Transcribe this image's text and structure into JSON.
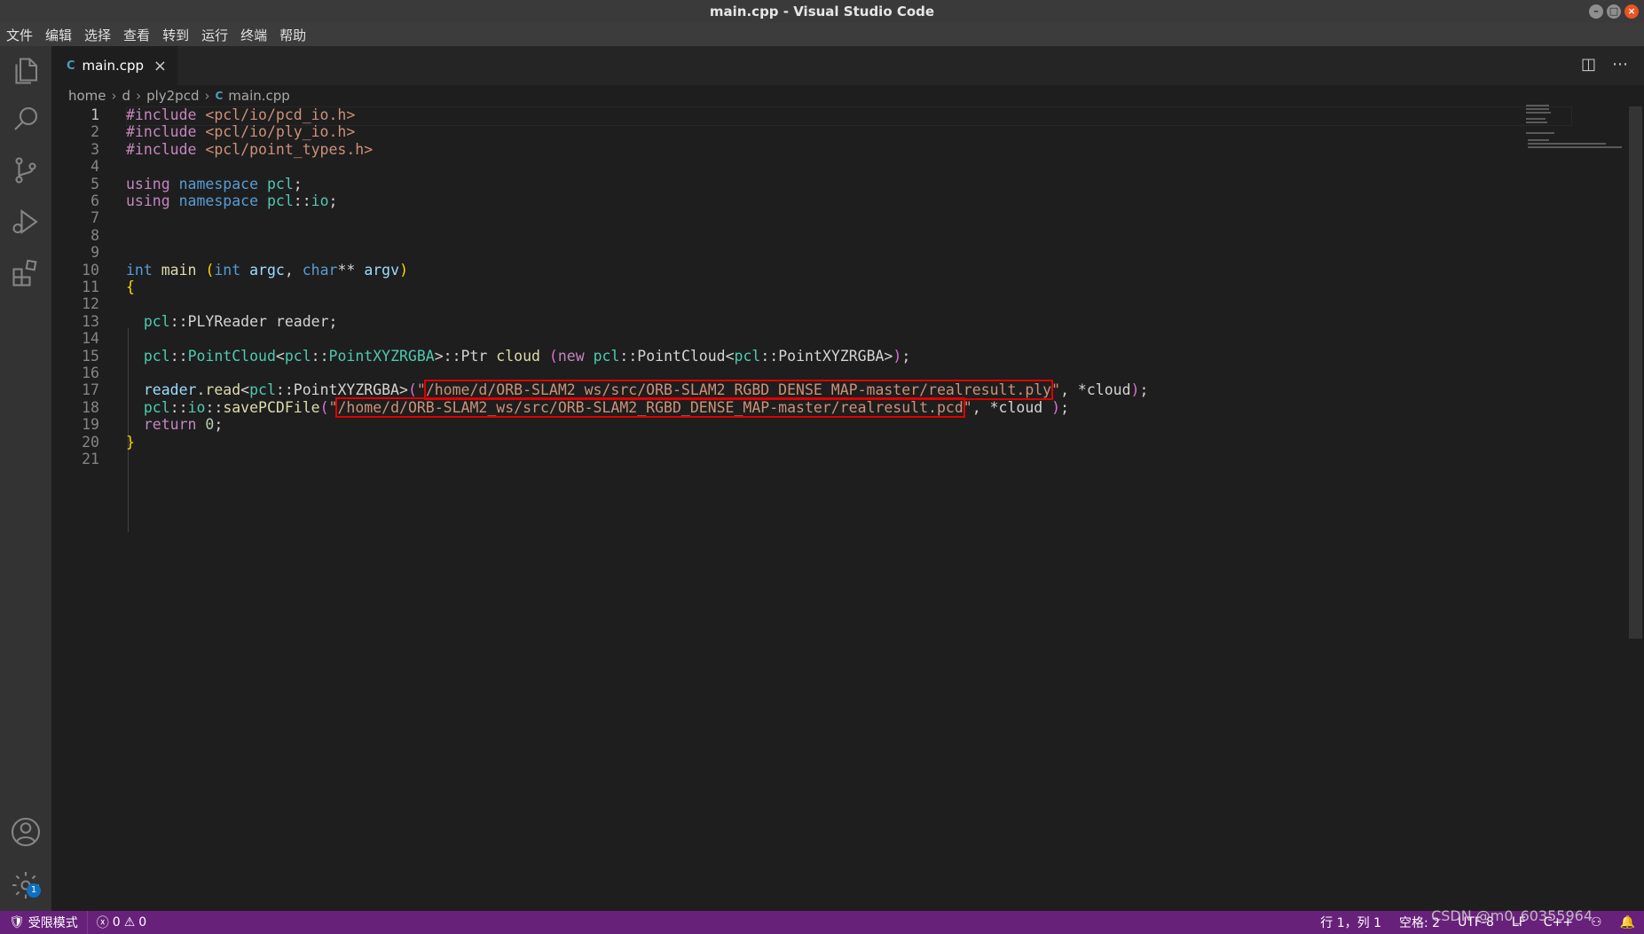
{
  "window": {
    "title": "main.cpp - Visual Studio Code"
  },
  "menu": [
    "文件",
    "编辑",
    "选择",
    "查看",
    "转到",
    "运行",
    "终端",
    "帮助"
  ],
  "activity": {
    "icons": [
      "files-icon",
      "search-icon",
      "source-control-icon",
      "run-debug-icon",
      "extensions-icon",
      "account-icon",
      "settings-gear-icon"
    ],
    "settings_badge": "1"
  },
  "tab": {
    "icon": "C",
    "label": "main.cpp",
    "close": "×"
  },
  "breadcrumb": {
    "parts": [
      "home",
      "d",
      "ply2pcd"
    ],
    "file_icon": "C",
    "file": "main.cpp",
    "sep": "›"
  },
  "editor": {
    "lines": [
      {
        "n": "1",
        "tokens": [
          [
            "kw",
            "#include"
          ],
          [
            "plain",
            " "
          ],
          [
            "str",
            "<pcl/io/pcd_io.h>"
          ]
        ]
      },
      {
        "n": "2",
        "tokens": [
          [
            "kw",
            "#include"
          ],
          [
            "plain",
            " "
          ],
          [
            "str",
            "<pcl/io/ply_io.h>"
          ]
        ]
      },
      {
        "n": "3",
        "tokens": [
          [
            "kw",
            "#include"
          ],
          [
            "plain",
            " "
          ],
          [
            "str",
            "<pcl/point_types.h>"
          ]
        ]
      },
      {
        "n": "4",
        "tokens": []
      },
      {
        "n": "5",
        "tokens": [
          [
            "kw",
            "using"
          ],
          [
            "plain",
            " "
          ],
          [
            "kw2",
            "namespace"
          ],
          [
            "plain",
            " "
          ],
          [
            "ns",
            "pcl"
          ],
          [
            "plain",
            ";"
          ]
        ]
      },
      {
        "n": "6",
        "tokens": [
          [
            "kw",
            "using"
          ],
          [
            "plain",
            " "
          ],
          [
            "kw2",
            "namespace"
          ],
          [
            "plain",
            " "
          ],
          [
            "ns",
            "pcl"
          ],
          [
            "plain",
            "::"
          ],
          [
            "ns",
            "io"
          ],
          [
            "plain",
            ";"
          ]
        ]
      },
      {
        "n": "7",
        "tokens": []
      },
      {
        "n": "8",
        "tokens": []
      },
      {
        "n": "9",
        "tokens": []
      },
      {
        "n": "10",
        "tokens": [
          [
            "kw2",
            "int"
          ],
          [
            "plain",
            " "
          ],
          [
            "fn",
            "main"
          ],
          [
            "plain",
            " "
          ],
          [
            "brace",
            "("
          ],
          [
            "kw2",
            "int"
          ],
          [
            "plain",
            " "
          ],
          [
            "var",
            "argc"
          ],
          [
            "plain",
            ", "
          ],
          [
            "kw2",
            "char"
          ],
          [
            "plain",
            "** "
          ],
          [
            "var",
            "argv"
          ],
          [
            "brace",
            ")"
          ]
        ]
      },
      {
        "n": "11",
        "tokens": [
          [
            "brace",
            "{"
          ]
        ]
      },
      {
        "n": "12",
        "tokens": []
      },
      {
        "n": "13",
        "tokens": [
          [
            "plain",
            "  "
          ],
          [
            "ns",
            "pcl"
          ],
          [
            "plain",
            "::PLYReader reader;"
          ]
        ]
      },
      {
        "n": "14",
        "tokens": []
      },
      {
        "n": "15",
        "tokens": [
          [
            "plain",
            "  "
          ],
          [
            "ns",
            "pcl"
          ],
          [
            "plain",
            "::"
          ],
          [
            "ns",
            "PointCloud"
          ],
          [
            "plain",
            "<"
          ],
          [
            "ns",
            "pcl"
          ],
          [
            "plain",
            "::"
          ],
          [
            "ns",
            "PointXYZRGBA"
          ],
          [
            "plain",
            ">::Ptr "
          ],
          [
            "fn",
            "cloud"
          ],
          [
            "plain",
            " "
          ],
          [
            "paren",
            "("
          ],
          [
            "kw",
            "new"
          ],
          [
            "plain",
            " "
          ],
          [
            "ns",
            "pcl"
          ],
          [
            "plain",
            "::PointCloud<"
          ],
          [
            "ns",
            "pcl"
          ],
          [
            "plain",
            "::PointXYZRGBA>"
          ],
          [
            "paren",
            ")"
          ],
          [
            "plain",
            ";"
          ]
        ]
      },
      {
        "n": "16",
        "tokens": []
      },
      {
        "n": "17",
        "tokens": [
          [
            "plain",
            "  "
          ],
          [
            "var",
            "reader"
          ],
          [
            "plain",
            "."
          ],
          [
            "fn",
            "read"
          ],
          [
            "plain",
            "<"
          ],
          [
            "ns",
            "pcl"
          ],
          [
            "plain",
            "::PointXYZRGBA>"
          ],
          [
            "paren",
            "("
          ],
          [
            "str",
            "\""
          ],
          [
            "str hl",
            "/home/d/ORB-SLAM2_ws/src/ORB-SLAM2_RGBD_DENSE_MAP-master/realresult.ply"
          ],
          [
            "str",
            "\""
          ],
          [
            "plain",
            ", *cloud"
          ],
          [
            "paren",
            ")"
          ],
          [
            "plain",
            ";"
          ]
        ]
      },
      {
        "n": "18",
        "tokens": [
          [
            "plain",
            "  "
          ],
          [
            "ns",
            "pcl"
          ],
          [
            "plain",
            "::"
          ],
          [
            "ns",
            "io"
          ],
          [
            "plain",
            "::"
          ],
          [
            "fn",
            "savePCDFile"
          ],
          [
            "paren",
            "("
          ],
          [
            "str",
            "\""
          ],
          [
            "str hl",
            "/home/d/ORB-SLAM2_ws/src/ORB-SLAM2_RGBD_DENSE_MAP-master/realresult.pcd"
          ],
          [
            "str",
            "\""
          ],
          [
            "plain",
            ", *cloud "
          ],
          [
            "paren",
            ")"
          ],
          [
            "plain",
            ";"
          ]
        ]
      },
      {
        "n": "19",
        "tokens": [
          [
            "plain",
            "  "
          ],
          [
            "kw",
            "return"
          ],
          [
            "plain",
            " "
          ],
          [
            "num",
            "0"
          ],
          [
            "plain",
            ";"
          ]
        ]
      },
      {
        "n": "20",
        "tokens": [
          [
            "brace",
            "}"
          ]
        ]
      },
      {
        "n": "21",
        "tokens": []
      }
    ]
  },
  "status": {
    "restricted": "受限模式",
    "errors": "0",
    "warnings": "0",
    "position": "行 1，列 1",
    "spaces": "空格: 2",
    "encoding": "UTF-8",
    "eol": "LF",
    "language": "C++"
  },
  "watermark": "CSDN @m0_60355964"
}
